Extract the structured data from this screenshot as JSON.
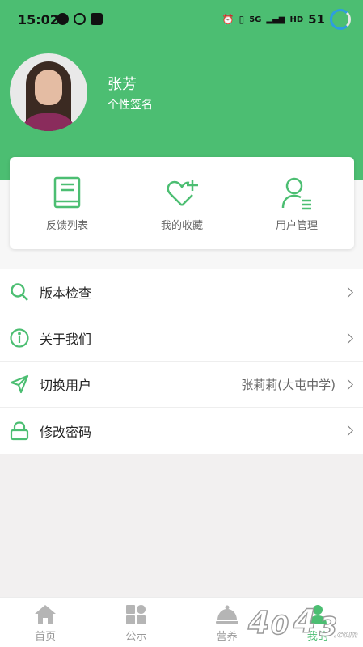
{
  "status_bar": {
    "time": "15:02",
    "signal_1": "5G",
    "signal_2": "HD",
    "battery": "51"
  },
  "profile": {
    "name": "张芳",
    "signature": "个性签名"
  },
  "quick_actions": [
    {
      "label": "反馈列表",
      "icon": "book-icon"
    },
    {
      "label": "我的收藏",
      "icon": "heart-plus-icon"
    },
    {
      "label": "用户管理",
      "icon": "user-list-icon"
    }
  ],
  "menu": [
    {
      "label": "版本检查",
      "icon": "search-icon",
      "value": ""
    },
    {
      "label": "关于我们",
      "icon": "info-icon",
      "value": ""
    },
    {
      "label": "切换用户",
      "icon": "send-icon",
      "value": "张莉莉(大屯中学)"
    },
    {
      "label": "修改密码",
      "icon": "lock-icon",
      "value": ""
    }
  ],
  "tabbar": [
    {
      "label": "首页",
      "icon": "home-icon"
    },
    {
      "label": "公示",
      "icon": "grid-icon"
    },
    {
      "label": "营养",
      "icon": "cloche-icon"
    },
    {
      "label": "我的",
      "icon": "person-icon"
    }
  ],
  "watermark": "4043",
  "colors": {
    "accent": "#4cbe72",
    "background": "#f2f0f0"
  }
}
